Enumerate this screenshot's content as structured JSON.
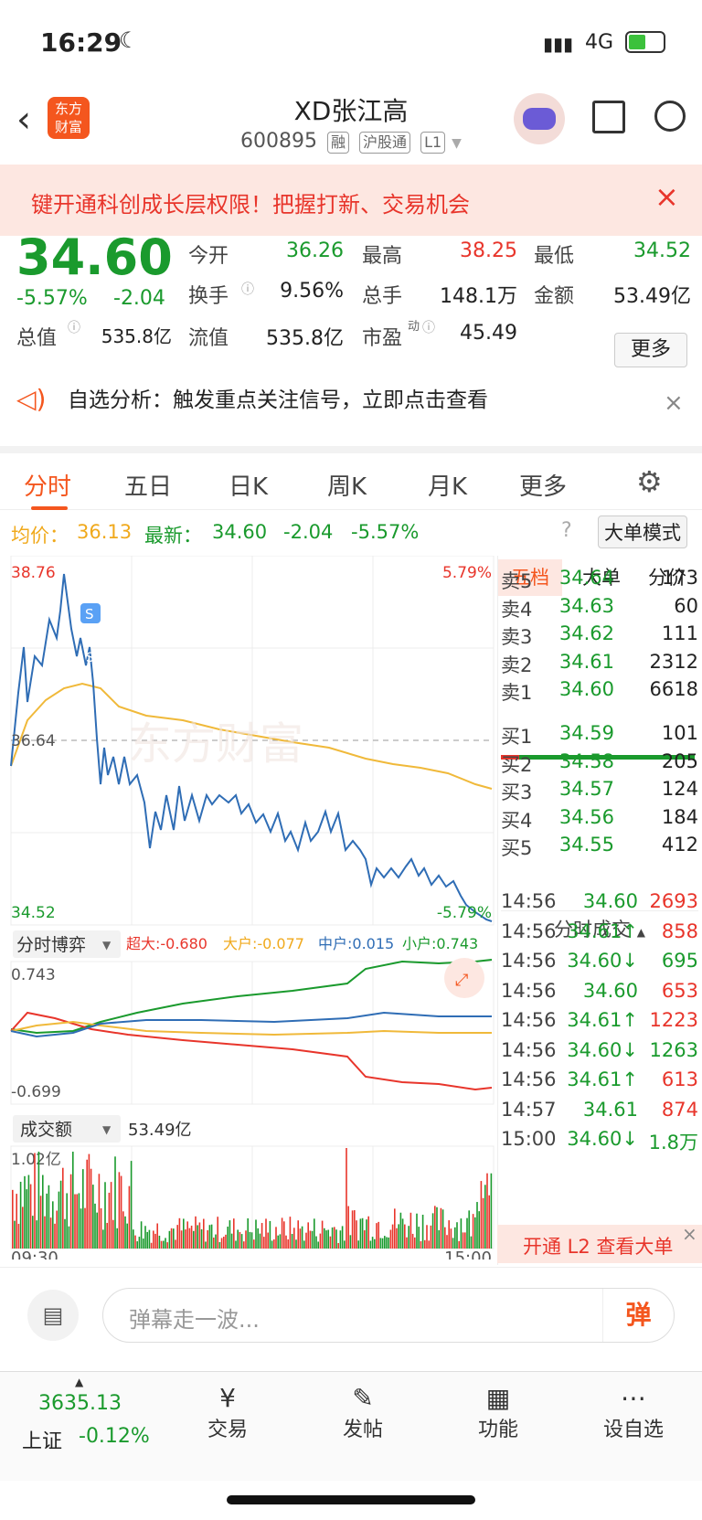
{
  "status": {
    "time": "16:29",
    "network": "4G"
  },
  "header": {
    "title": "XD张江高",
    "code": "600895",
    "tags": [
      "融",
      "沪股通",
      "L1"
    ],
    "logo_text": "东方财富"
  },
  "banner": {
    "text": "键开通科创成长层权限！把握打新、交易机会"
  },
  "quote": {
    "price": "34.60",
    "change_pct": "-5.57%",
    "change": "-2.04",
    "open_label": "今开",
    "open": "36.26",
    "high_label": "最高",
    "high": "38.25",
    "low_label": "最低",
    "low": "34.52",
    "turnover_label": "换手",
    "turnover": "9.56%",
    "volume_label": "总手",
    "volume": "148.1万",
    "amount_label": "金额",
    "amount": "53.49亿",
    "mktcap_label": "总值",
    "mktcap": "535.8亿",
    "float_label": "流值",
    "float": "535.8亿",
    "pe_label": "市盈",
    "pe_sup": "动",
    "pe": "45.49",
    "more": "更多"
  },
  "tip": {
    "text": "自选分析：触发重点关注信号，立即点击查看"
  },
  "tabs": [
    "分时",
    "五日",
    "日K",
    "周K",
    "月K",
    "更多"
  ],
  "chart_head": {
    "avg_label": "均价：",
    "avg": "36.13",
    "last_label": "最新：",
    "last": "34.60",
    "chg": "-2.04",
    "pct": "-5.57%",
    "mode": "大单模式"
  },
  "axis": {
    "top": "38.76",
    "mid": "36.64",
    "bottom": "34.52",
    "top_pct": "5.79%",
    "bottom_pct": "-5.79%",
    "start": "09:30",
    "end": "15:00"
  },
  "game": {
    "label": "分时博弈",
    "super": "超大:-0.680",
    "large": "大户:-0.077",
    "mid": "中户:0.015",
    "small": "小户:0.743",
    "top": "0.743",
    "bottom": "-0.699"
  },
  "vol": {
    "label": "成交额",
    "total": "53.49亿",
    "max": "1.02亿"
  },
  "side_tabs": [
    "五档",
    "大单",
    "分价"
  ],
  "asks": [
    {
      "label": "卖5",
      "price": "34.64",
      "vol": "173"
    },
    {
      "label": "卖4",
      "price": "34.63",
      "vol": "60"
    },
    {
      "label": "卖3",
      "price": "34.62",
      "vol": "111"
    },
    {
      "label": "卖2",
      "price": "34.61",
      "vol": "2312"
    },
    {
      "label": "卖1",
      "price": "34.60",
      "vol": "6618"
    }
  ],
  "bids": [
    {
      "label": "买1",
      "price": "34.59",
      "vol": "101"
    },
    {
      "label": "买2",
      "price": "34.58",
      "vol": "205"
    },
    {
      "label": "买3",
      "price": "34.57",
      "vol": "124"
    },
    {
      "label": "买4",
      "price": "34.56",
      "vol": "184"
    },
    {
      "label": "买5",
      "price": "34.55",
      "vol": "412"
    }
  ],
  "trades_label": "分时成交",
  "trades": [
    {
      "time": "14:56",
      "price": "34.60",
      "vol": "2693"
    },
    {
      "time": "14:56",
      "price": "34.61↑",
      "vol": "858"
    },
    {
      "time": "14:56",
      "price": "34.60↓",
      "vol": "695"
    },
    {
      "time": "14:56",
      "price": "34.60",
      "vol": "653"
    },
    {
      "time": "14:56",
      "price": "34.61↑",
      "vol": "1223"
    },
    {
      "time": "14:56",
      "price": "34.60↓",
      "vol": "1263"
    },
    {
      "time": "14:56",
      "price": "34.61↑",
      "vol": "613"
    },
    {
      "time": "14:57",
      "price": "34.61",
      "vol": "874"
    },
    {
      "time": "15:00",
      "price": "34.60↓",
      "vol": "1.8万"
    }
  ],
  "l2": {
    "text": "开通 L2 查看大单"
  },
  "danmu": {
    "placeholder": "弹幕走一波...",
    "send": "弹"
  },
  "tabbar": {
    "index_value": "3635.13",
    "index_name": "上证",
    "index_pct": "-0.12%",
    "items": [
      "交易",
      "发帖",
      "功能",
      "设自选"
    ]
  },
  "colors": {
    "up": "#e8352b",
    "down": "#1a9a2d",
    "avg": "#f0b93a",
    "price_line": "#2f6db5"
  }
}
